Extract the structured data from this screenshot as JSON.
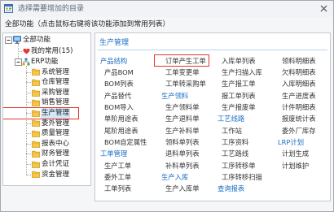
{
  "window": {
    "title": "选择需要增加的目录",
    "title_icon": "window-icon",
    "close_icon": "close-icon"
  },
  "instruction": "全部功能（点击鼠标右键将该功能添加到常用列表）",
  "tree": {
    "root": {
      "label": "全部功能",
      "icon": "monitor-icon",
      "expanded": true
    },
    "favorites": {
      "label": "我的常用(15)",
      "icon": "heart-icon"
    },
    "erp": {
      "label": "ERP功能",
      "icon": "erp-icon",
      "expanded": true,
      "modules": [
        {
          "label": "系统管理",
          "icon": "folder-icon"
        },
        {
          "label": "仓库管理",
          "icon": "folder-icon"
        },
        {
          "label": "采购管理",
          "icon": "folder-icon"
        },
        {
          "label": "销售管理",
          "icon": "folder-icon"
        },
        {
          "label": "生产管理",
          "icon": "folder-icon",
          "selected": true,
          "highlighted": true
        },
        {
          "label": "委外管理",
          "icon": "folder-icon"
        },
        {
          "label": "质量管理",
          "icon": "folder-icon"
        },
        {
          "label": "报表中心",
          "icon": "folder-icon"
        },
        {
          "label": "财务管理",
          "icon": "folder-icon"
        },
        {
          "label": "会计凭证",
          "icon": "folder-icon"
        },
        {
          "label": "资金管理",
          "icon": "folder-icon"
        }
      ]
    }
  },
  "content": {
    "heading": "生产管理",
    "columns": [
      {
        "items": [
          {
            "label": "产品结构",
            "category": true
          },
          {
            "label": "产品BOM"
          },
          {
            "label": "BOM列表"
          },
          {
            "label": "产品替代"
          },
          {
            "label": "BOM导入"
          },
          {
            "label": "单阶用途表"
          },
          {
            "label": "尾阶用途表"
          },
          {
            "label": "BOM自定属性"
          },
          {
            "label": "工单管理",
            "category": true
          },
          {
            "label": "生产工单"
          },
          {
            "label": "委外工单"
          },
          {
            "label": "工单列表"
          }
        ]
      },
      {
        "items": [
          {
            "label": "订单产生工单",
            "highlighted": true
          },
          {
            "label": "工单变更单"
          },
          {
            "label": "工单转采购单"
          },
          {
            "label": "生产领料",
            "category": true
          },
          {
            "label": "生产领料单"
          },
          {
            "label": "生产退料单"
          },
          {
            "label": "生产补料单"
          },
          {
            "label": "领料单列表"
          },
          {
            "label": "退料单列表"
          },
          {
            "label": "补料单列表"
          },
          {
            "label": "生产入库",
            "category": true
          },
          {
            "label": "生产入库单"
          }
        ]
      },
      {
        "items": [
          {
            "label": "入库单列表"
          },
          {
            "label": "生产扫描入库"
          },
          {
            "label": "生产报工单"
          },
          {
            "label": "报工单列表"
          },
          {
            "label": "生产报废单"
          },
          {
            "label": "工艺线路",
            "category": true
          },
          {
            "label": "工作站"
          },
          {
            "label": "工序资料"
          },
          {
            "label": "工艺路线"
          },
          {
            "label": "工序转移单"
          },
          {
            "label": "工序转移扫描"
          },
          {
            "label": "查询报表",
            "category": true
          }
        ]
      },
      {
        "items": [
          {
            "label": "领料明细表"
          },
          {
            "label": "欠料明细表"
          },
          {
            "label": "入库明细表"
          },
          {
            "label": "生产进度表"
          },
          {
            "label": "计件明细表"
          },
          {
            "label": "报废统计表"
          },
          {
            "label": "委外厂库存"
          },
          {
            "label": "LRP计划",
            "category": true
          },
          {
            "label": "计划生成"
          },
          {
            "label": "计划维护"
          }
        ]
      }
    ]
  },
  "colors": {
    "accent": "#1a6cc4",
    "highlight_red": "#e2372b",
    "selection_bg": "#d5e6f7",
    "title_text": "#5c6878",
    "item_text": "#333333"
  }
}
